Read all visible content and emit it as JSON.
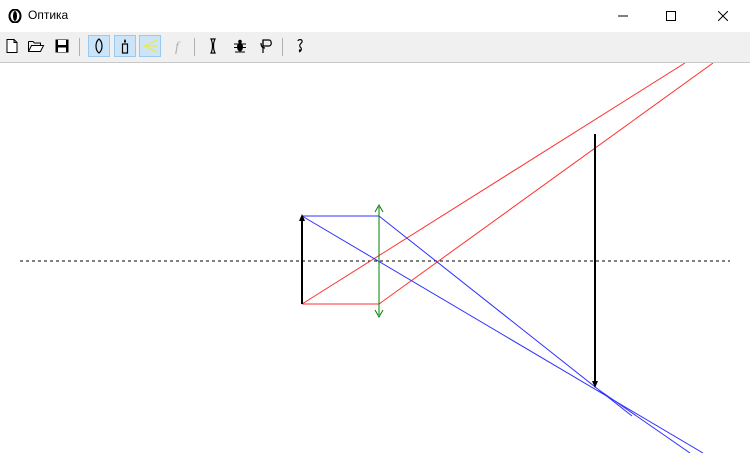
{
  "window": {
    "title": "Оптика",
    "icons": {
      "app": "lens-app-icon",
      "minimize": "minimize-icon",
      "maximize": "maximize-icon",
      "close": "close-icon"
    }
  },
  "toolbar": {
    "buttons": [
      {
        "name": "new-file",
        "icon": "new-document-icon",
        "active": false
      },
      {
        "name": "open-file",
        "icon": "open-folder-icon",
        "active": false
      },
      {
        "name": "save-file",
        "icon": "save-disk-icon",
        "active": false
      },
      {
        "name": "lens-tool",
        "icon": "lens-icon",
        "active": true
      },
      {
        "name": "object-tool",
        "icon": "candle-icon",
        "active": true
      },
      {
        "name": "rays-tool",
        "icon": "rays-icon",
        "active": true
      },
      {
        "name": "focus-tool",
        "icon": "focus-f-icon",
        "active": false,
        "label": "f"
      },
      {
        "name": "concave-lens-tool",
        "icon": "concave-lens-icon",
        "active": false
      },
      {
        "name": "debug-tool",
        "icon": "bug-icon",
        "active": false
      },
      {
        "name": "info-tool",
        "icon": "info-book-icon",
        "active": false
      },
      {
        "name": "help-tool",
        "icon": "help-icon",
        "active": false
      }
    ]
  },
  "colors": {
    "axis": "#000000",
    "lens": "#008000",
    "object": "#000000",
    "image": "#000000",
    "ray_red": "#ff2020",
    "ray_blue": "#2020ff",
    "toolbar_bg": "#f0f0f0",
    "active_bg": "#cce4f7"
  }
}
